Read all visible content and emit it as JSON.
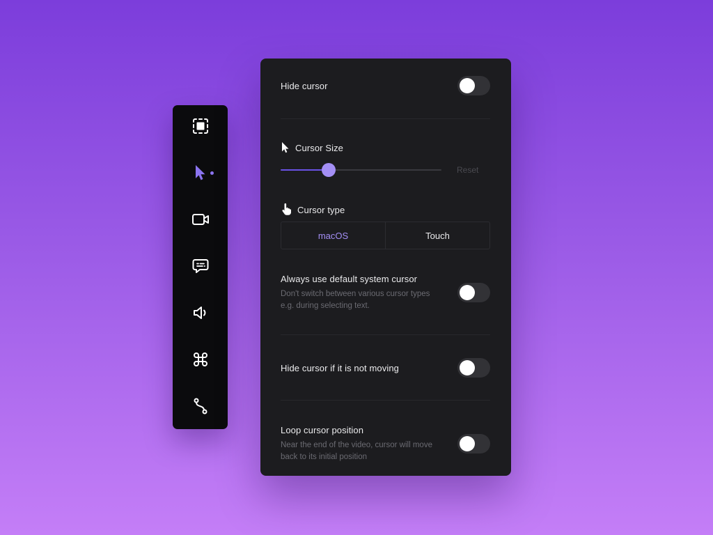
{
  "toolbar": {
    "tools": [
      {
        "icon": "selection-frame-icon",
        "active": false
      },
      {
        "icon": "cursor-arrow-icon",
        "active": true
      },
      {
        "icon": "video-camera-icon",
        "active": false
      },
      {
        "icon": "chat-bubble-icon",
        "active": false
      },
      {
        "icon": "speaker-icon",
        "active": false
      },
      {
        "icon": "command-key-icon",
        "active": false
      },
      {
        "icon": "path-curve-icon",
        "active": false
      }
    ],
    "accent": "#8b74f0"
  },
  "settings": {
    "hide_cursor": {
      "label": "Hide cursor",
      "enabled": false
    },
    "cursor_size": {
      "label": "Cursor Size",
      "icon": "cursor-arrow-icon",
      "value_fraction": 0.3,
      "reset_label": "Reset"
    },
    "cursor_type": {
      "label": "Cursor type",
      "icon": "hand-pointer-icon",
      "options": [
        "macOS",
        "Touch"
      ],
      "selected": "macOS"
    },
    "default_system_cursor": {
      "label": "Always use default system cursor",
      "description": "Don't switch between various cursor types e.g. during selecting text.",
      "enabled": false
    },
    "hide_if_not_moving": {
      "label": "Hide cursor if it is not moving",
      "enabled": false
    },
    "loop_cursor_position": {
      "label": "Loop cursor position",
      "description": "Near the end of the video, cursor will move back to its initial position",
      "enabled": false
    }
  },
  "colors": {
    "accent": "#a48ff5",
    "panel_bg": "#1c1c1f",
    "toolbar_bg": "#0b0b0d",
    "background_top": "#7c3ddb",
    "background_bottom": "#c47ef7"
  }
}
